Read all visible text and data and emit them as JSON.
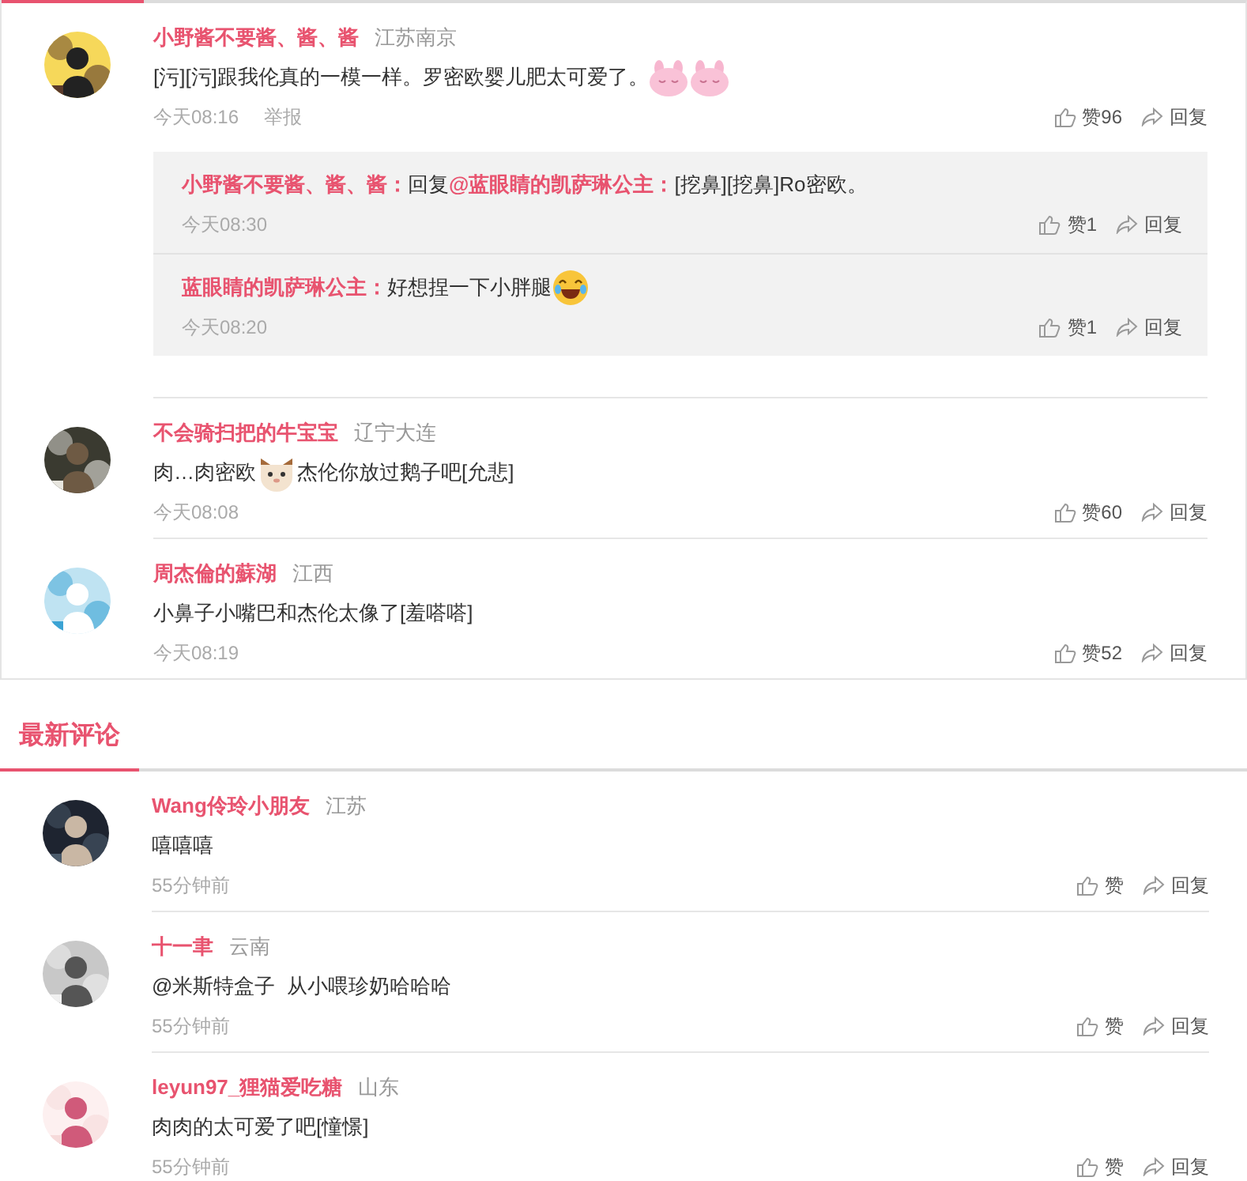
{
  "hot_comments": [
    {
      "author": "小野酱不要酱、酱、酱",
      "location": "江苏南京",
      "segments": [
        {
          "kind": "text",
          "text": "[污][污]跟我伦真的一模一样。罗密欧婴儿肥太可爱了。"
        },
        {
          "kind": "rabbit"
        },
        {
          "kind": "rabbit"
        }
      ],
      "time": "今天08:16",
      "report": "举报",
      "likes": "赞96",
      "reply": "回复",
      "replies": [
        {
          "author": "小野酱不要酱、酱、酱：",
          "segments": [
            {
              "kind": "text",
              "text": "回复"
            },
            {
              "kind": "mention",
              "text": "@蓝眼睛的凯萨琳公主："
            },
            {
              "kind": "text",
              "text": "[挖鼻][挖鼻]Ro密欧。"
            }
          ],
          "time": "今天08:30",
          "likes": "赞1",
          "reply": "回复"
        },
        {
          "author": "蓝眼睛的凯萨琳公主：",
          "segments": [
            {
              "kind": "text",
              "text": "好想捏一下小胖腿"
            },
            {
              "kind": "laugh"
            }
          ],
          "time": "今天08:20",
          "likes": "赞1",
          "reply": "回复"
        }
      ]
    },
    {
      "author": "不会骑扫把的牛宝宝",
      "location": "辽宁大连",
      "segments": [
        {
          "kind": "text",
          "text": "肉…肉密欧"
        },
        {
          "kind": "cat"
        },
        {
          "kind": "text",
          "text": "杰伦你放过鹅子吧[允悲]"
        }
      ],
      "time": "今天08:08",
      "likes": "赞60",
      "reply": "回复"
    },
    {
      "author": "周杰倫的蘇湖",
      "location": "江西",
      "segments": [
        {
          "kind": "text",
          "text": "小鼻子小嘴巴和杰伦太像了[羞嗒嗒]"
        }
      ],
      "time": "今天08:19",
      "likes": "赞52",
      "reply": "回复"
    }
  ],
  "latest": {
    "title": "最新评论",
    "comments": [
      {
        "author": "Wang伶玲小朋友",
        "location": "江苏",
        "segments": [
          {
            "kind": "text",
            "text": "嘻嘻嘻"
          }
        ],
        "time": "55分钟前",
        "likes": "赞",
        "reply": "回复"
      },
      {
        "author": "十一聿",
        "location": "云南",
        "segments": [
          {
            "kind": "text",
            "text": "@米斯特盒子  从小喂珍奶哈哈哈"
          }
        ],
        "time": "55分钟前",
        "likes": "赞",
        "reply": "回复"
      },
      {
        "author": "leyun97_狸猫爱吃糖",
        "location": "山东",
        "segments": [
          {
            "kind": "text",
            "text": "肉肉的太可爱了吧[憧憬]"
          }
        ],
        "time": "55分钟前",
        "likes": "赞",
        "reply": "回复"
      }
    ]
  }
}
